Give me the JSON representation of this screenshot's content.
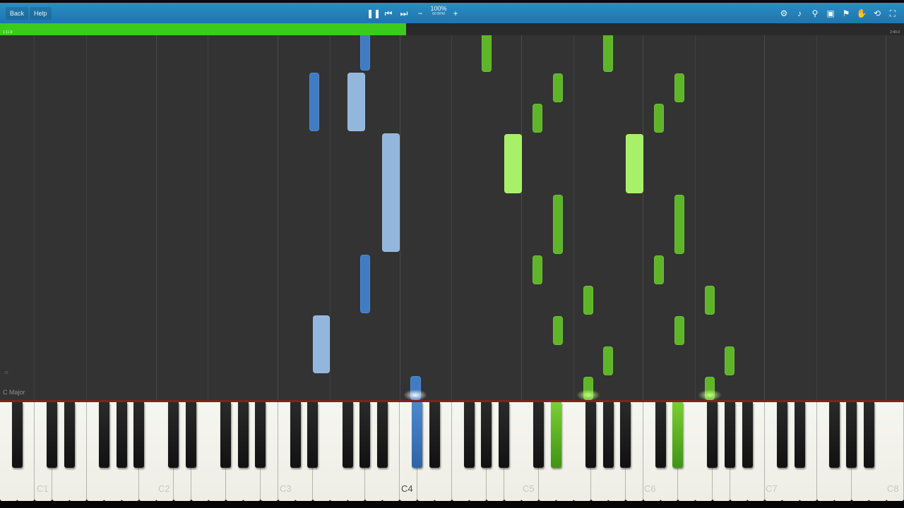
{
  "toolbar": {
    "back_label": "Back",
    "help_label": "Help",
    "speed_percent": "100%",
    "speed_bpm": "60 BPM",
    "icons": [
      "pause-icon",
      "previous-icon",
      "next-icon",
      "minus-icon",
      "plus-icon",
      "settings-gear-icon",
      "metronome-icon",
      "search-icon",
      "label-icon",
      "bookmark-icon",
      "hand-icon",
      "loop-icon",
      "fullscreen-icon"
    ]
  },
  "timeline": {
    "current_time": "1:11.8",
    "total_time": "2:40.0",
    "progress_fraction": 0.449,
    "fill_color": "#3ccb1d"
  },
  "roll": {
    "key_signature": "C Major",
    "measure_number": "19",
    "colors": {
      "left_hand_dark": "#3f7cc4",
      "left_hand_light": "#93b6dc",
      "right_hand_dark": "#5eb527",
      "right_hand_light": "#a8f067"
    }
  },
  "keyboard": {
    "octave_labels": [
      "C1",
      "C2",
      "C3",
      "C4",
      "C5",
      "C6",
      "C7",
      "C8"
    ],
    "pressed_keys": [
      {
        "key": "C#4",
        "hand": "left",
        "color": "#3f7cc4"
      },
      {
        "key": "D#5",
        "hand": "right",
        "color": "#5eb527"
      },
      {
        "key": "D#6",
        "hand": "right",
        "color": "#5eb527"
      }
    ]
  }
}
